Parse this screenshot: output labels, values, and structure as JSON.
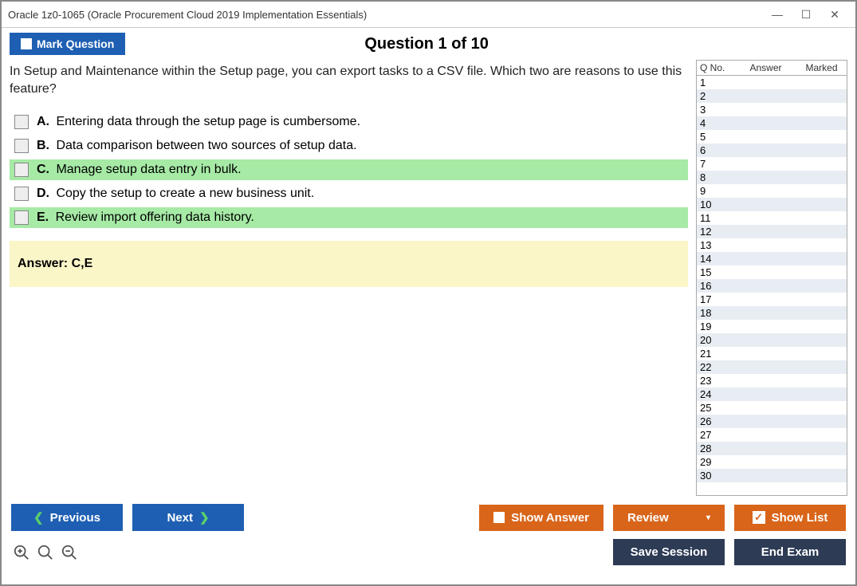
{
  "window_title": "Oracle 1z0-1065 (Oracle Procurement Cloud 2019 Implementation Essentials)",
  "header": {
    "mark_label": "Mark Question",
    "question_title": "Question 1 of 10"
  },
  "question": {
    "text": "In Setup and Maintenance within the Setup page, you can export tasks to a CSV file. Which two are reasons to use this feature?",
    "choices": [
      {
        "letter": "A.",
        "text": "Entering data through the setup page is cumbersome.",
        "correct": false
      },
      {
        "letter": "B.",
        "text": "Data comparison between two sources of setup data.",
        "correct": false
      },
      {
        "letter": "C.",
        "text": "Manage setup data entry in bulk.",
        "correct": true
      },
      {
        "letter": "D.",
        "text": "Copy the setup to create a new business unit.",
        "correct": false
      },
      {
        "letter": "E.",
        "text": "Review import offering data history.",
        "correct": true
      }
    ],
    "answer_label": "Answer: C,E"
  },
  "sidebar": {
    "col_qno": "Q No.",
    "col_answer": "Answer",
    "col_marked": "Marked",
    "rows": [
      1,
      2,
      3,
      4,
      5,
      6,
      7,
      8,
      9,
      10,
      11,
      12,
      13,
      14,
      15,
      16,
      17,
      18,
      19,
      20,
      21,
      22,
      23,
      24,
      25,
      26,
      27,
      28,
      29,
      30
    ]
  },
  "footer": {
    "previous": "Previous",
    "next": "Next",
    "show_answer": "Show Answer",
    "review": "Review",
    "show_list": "Show List",
    "save_session": "Save Session",
    "end_exam": "End Exam"
  }
}
